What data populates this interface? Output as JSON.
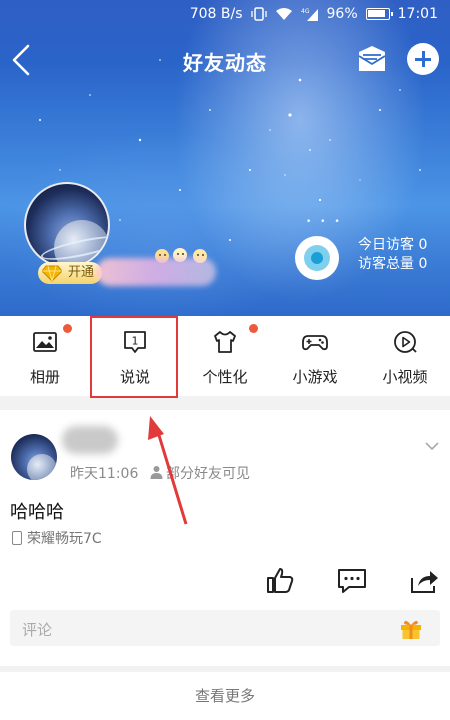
{
  "status_bar": {
    "network_speed": "708 B/s",
    "battery_percent": "96%",
    "time": "17:01"
  },
  "header": {
    "title": "好友动态"
  },
  "profile": {
    "vip_label": "开通"
  },
  "visitors": {
    "today_label": "今日访客",
    "today_count": "0",
    "total_label": "访客总量",
    "total_count": "0"
  },
  "tabs": [
    {
      "label": "相册",
      "icon": "photo-album-icon",
      "badge": true
    },
    {
      "label": "说说",
      "icon": "shuoshuo-icon",
      "icon_number": "1",
      "badge": false
    },
    {
      "label": "个性化",
      "icon": "tshirt-icon",
      "badge": true
    },
    {
      "label": "小游戏",
      "icon": "gamepad-icon",
      "badge": false
    },
    {
      "label": "小视频",
      "icon": "play-icon",
      "badge": false
    }
  ],
  "post": {
    "time": "昨天11:06",
    "visibility": "部分好友可见",
    "text": "哈哈哈",
    "device": "荣耀畅玩7C"
  },
  "comment": {
    "placeholder": "评论"
  },
  "footer": {
    "see_more": "查看更多"
  },
  "colors": {
    "accent_red": "#e23a3a",
    "badge_red": "#ef5a3c",
    "header_blue": "#2f6cd0"
  }
}
